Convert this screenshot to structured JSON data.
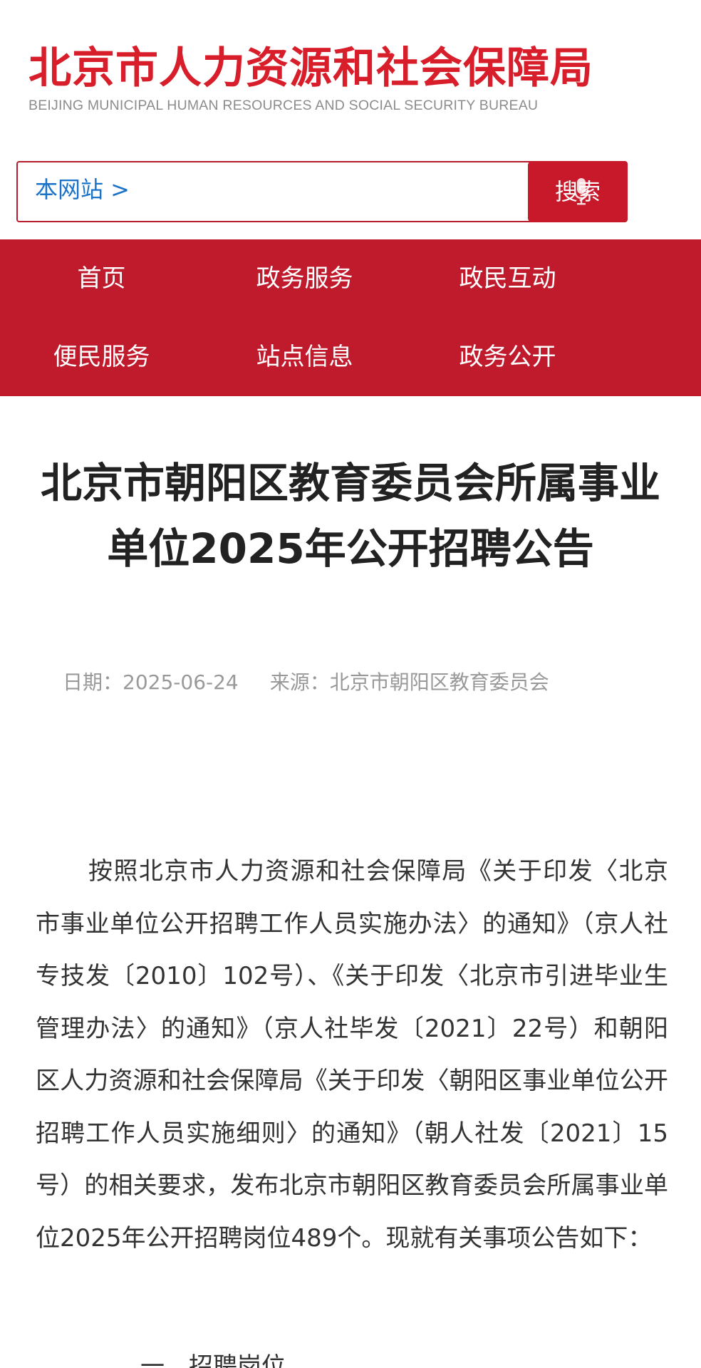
{
  "header": {
    "logo_cn": "北京市人力资源和社会保障局",
    "logo_en": "BEIJING MUNICIPAL HUMAN RESOURCES AND SOCIAL SECURITY BUREAU"
  },
  "search": {
    "scope": "本网站 >",
    "placeholder": "",
    "button_label": "搜索"
  },
  "nav": {
    "items": [
      "首页",
      "政务服务",
      "政民互动",
      "便民服务",
      "站点信息",
      "政务公开"
    ]
  },
  "article": {
    "title": "北京市朝阳区教育委员会所属事业单位2025年公开招聘公告",
    "date_label": "日期：",
    "date": "2025-06-24",
    "source_label": "来源：",
    "source": "北京市朝阳区教育委员会",
    "paragraph1": "按照北京市人力资源和社会保障局《关于印发〈北京市事业单位公开招聘工作人员实施办法〉的通知》（京人社专技发〔2010〕102号）、《关于印发〈北京市引进毕业生管理办法〉的通知》（京人社毕发〔2021〕22号）和朝阳区人力资源和社会保障局《关于印发〈朝阳区事业单位公开招聘工作人员实施细则〉的通知》（朝人社发〔2021〕15号）的相关要求，发布北京市朝阳区教育委员会所属事业单位2025年公开招聘岗位489个。现就有关事项公告如下：",
    "section_heading": "一、招聘岗位"
  },
  "colors": {
    "brand_red": "#c01b2d",
    "logo_red": "#d81e2a",
    "link_blue": "#1a73c8"
  }
}
